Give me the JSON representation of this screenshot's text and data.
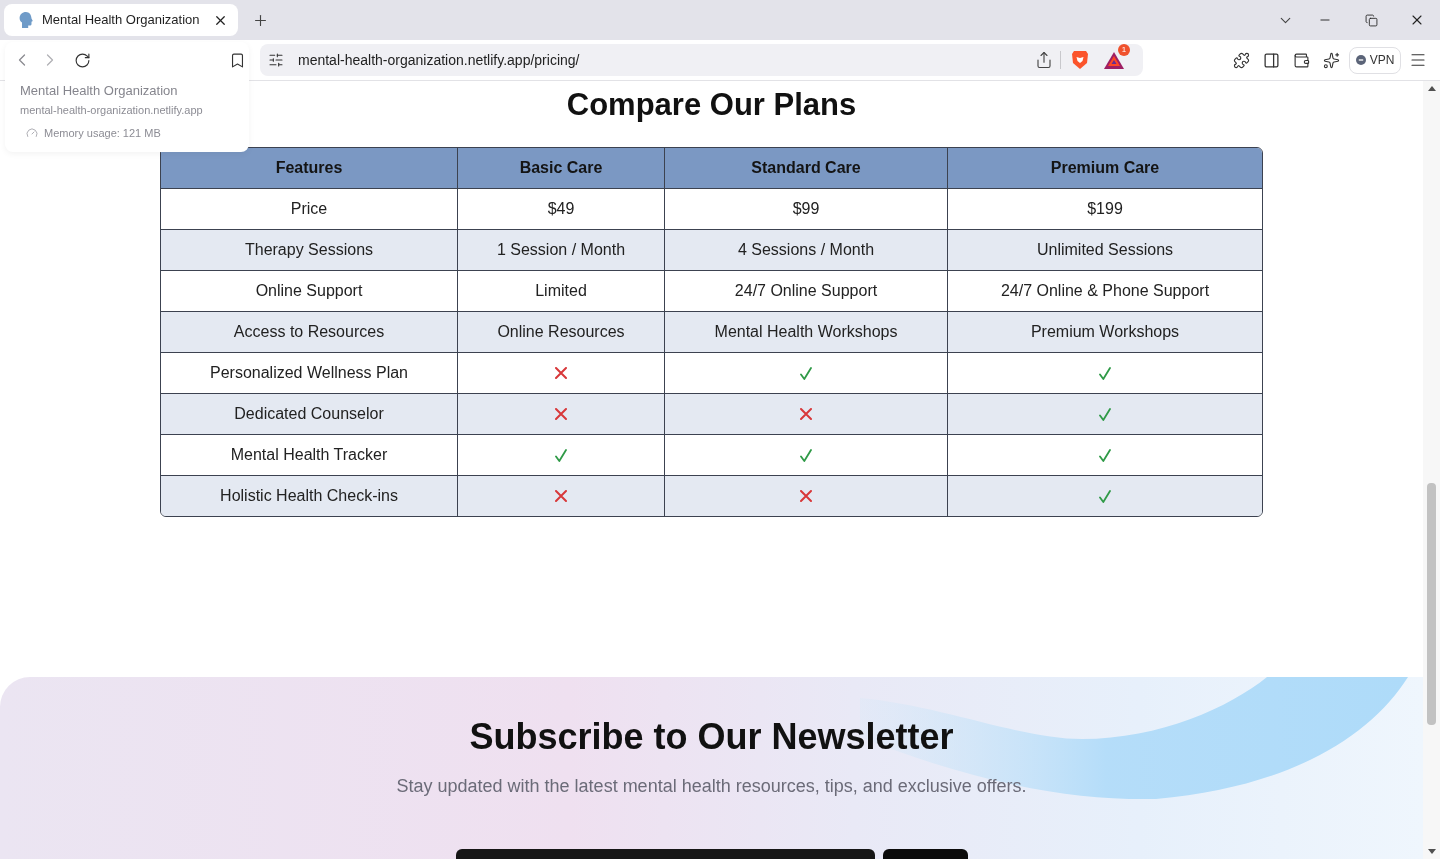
{
  "browser": {
    "tab": {
      "title": "Mental Health Organization",
      "selected": true
    },
    "hover_card": {
      "title": "Mental Health Organization",
      "url": "mental-health-organization.netlify.app",
      "memory": "Memory usage: 121 MB"
    },
    "address_bar": {
      "url": "mental-health-organization.netlify.app/pricing/"
    },
    "rewards_badge": "1",
    "vpn": {
      "label": "VPN"
    }
  },
  "comparison": {
    "title": "Compare Our Plans",
    "columns": [
      "Features",
      "Basic Care",
      "Standard Care",
      "Premium Care"
    ],
    "rows": [
      {
        "cells": [
          {
            "kind": "text",
            "text": "Price"
          },
          {
            "kind": "text",
            "text": "$49"
          },
          {
            "kind": "text",
            "text": "$99"
          },
          {
            "kind": "text",
            "text": "$199"
          }
        ]
      },
      {
        "cells": [
          {
            "kind": "text",
            "text": "Therapy Sessions"
          },
          {
            "kind": "text",
            "text": "1 Session / Month"
          },
          {
            "kind": "text",
            "text": "4 Sessions / Month"
          },
          {
            "kind": "text",
            "text": "Unlimited Sessions"
          }
        ]
      },
      {
        "cells": [
          {
            "kind": "text",
            "text": "Online Support"
          },
          {
            "kind": "text",
            "text": "Limited"
          },
          {
            "kind": "text",
            "text": "24/7 Online Support"
          },
          {
            "kind": "text",
            "text": "24/7 Online & Phone Support"
          }
        ]
      },
      {
        "cells": [
          {
            "kind": "text",
            "text": "Access to Resources"
          },
          {
            "kind": "text",
            "text": "Online Resources"
          },
          {
            "kind": "text",
            "text": "Mental Health Workshops"
          },
          {
            "kind": "text",
            "text": "Premium Workshops"
          }
        ]
      },
      {
        "cells": [
          {
            "kind": "text",
            "text": "Personalized Wellness Plan"
          },
          {
            "kind": "mark",
            "included": false
          },
          {
            "kind": "mark",
            "included": true
          },
          {
            "kind": "mark",
            "included": true
          }
        ]
      },
      {
        "cells": [
          {
            "kind": "text",
            "text": "Dedicated Counselor"
          },
          {
            "kind": "mark",
            "included": false
          },
          {
            "kind": "mark",
            "included": false
          },
          {
            "kind": "mark",
            "included": true
          }
        ]
      },
      {
        "cells": [
          {
            "kind": "text",
            "text": "Mental Health Tracker"
          },
          {
            "kind": "mark",
            "included": true
          },
          {
            "kind": "mark",
            "included": true
          },
          {
            "kind": "mark",
            "included": true
          }
        ]
      },
      {
        "cells": [
          {
            "kind": "text",
            "text": "Holistic Health Check-ins"
          },
          {
            "kind": "mark",
            "included": false
          },
          {
            "kind": "mark",
            "included": false
          },
          {
            "kind": "mark",
            "included": true
          }
        ]
      }
    ]
  },
  "newsletter": {
    "title": "Subscribe to Our Newsletter",
    "subtitle": "Stay updated with the latest mental health resources, tips, and exclusive offers."
  }
}
